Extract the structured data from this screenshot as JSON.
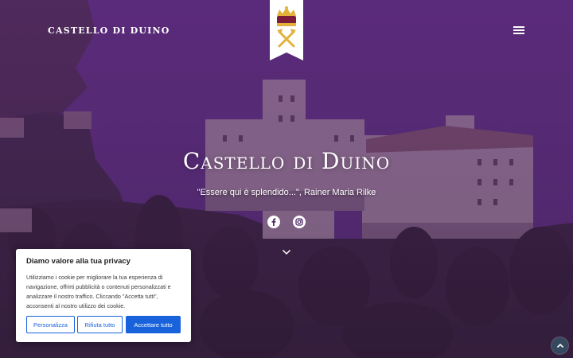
{
  "header": {
    "brand": "CASTELLO DI DUINO",
    "crest_icon": "crown-pickaxes-crest",
    "menu_icon": "hamburger-menu"
  },
  "hero": {
    "title": "Castello di Duino",
    "quote": "\"Essere qui è splendido...\", Rainer Maria Rilke",
    "social": [
      "facebook",
      "instagram"
    ]
  },
  "cookie_banner": {
    "title": "Diamo valore alla tua privacy",
    "text": "Utilizziamo i cookie per migliorare la tua esperienza di navigazione, offrirti pubblicità o contenuti personalizzati e analizzare il nostro traffico. Cliccando \"Accetta tutti\", acconsenti al nostro utilizzo dei cookie.",
    "customize_label": "Personalizza",
    "reject_label": "Rifiuta tutto",
    "accept_label": "Accettare tutto"
  },
  "colors": {
    "overlay": "#4a2662",
    "button_blue": "#1863dc",
    "scroll_top_bg": "#34495e"
  }
}
